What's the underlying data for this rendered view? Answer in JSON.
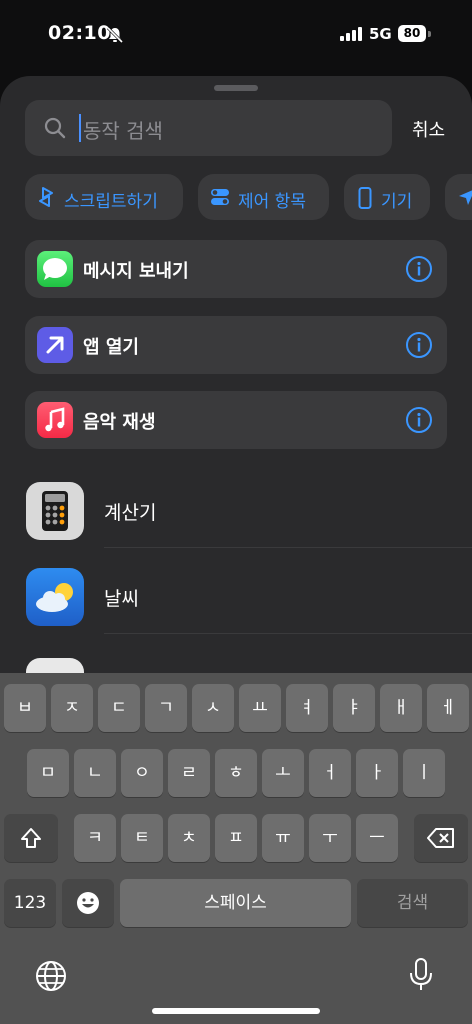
{
  "status_bar": {
    "time": "02:10",
    "network": "5G",
    "battery": "80"
  },
  "search": {
    "placeholder": "동작 검색",
    "cancel_label": "취소"
  },
  "chips": [
    {
      "label": "스크립트하기",
      "icon": "shortcut-icon"
    },
    {
      "label": "제어 항목",
      "icon": "toggle-icon"
    },
    {
      "label": "기기",
      "icon": "phone-icon"
    },
    {
      "label": "",
      "icon": "location-arrow-icon"
    }
  ],
  "suggestions": [
    {
      "label": "메시지 보내기",
      "icon": "messages-icon",
      "color": "#34c759"
    },
    {
      "label": "앱 열기",
      "icon": "arrow-up-right-icon",
      "color": "#5e5ce6"
    },
    {
      "label": "음악 재생",
      "icon": "music-icon",
      "color": "#fa2d48"
    }
  ],
  "apps": [
    {
      "label": "계산기",
      "icon": "calculator-icon"
    },
    {
      "label": "날씨",
      "icon": "weather-icon"
    }
  ],
  "keyboard": {
    "row1": [
      "ㅂ",
      "ㅈ",
      "ㄷ",
      "ㄱ",
      "ㅅ",
      "ㅛ",
      "ㅕ",
      "ㅑ",
      "ㅐ",
      "ㅔ"
    ],
    "row2": [
      "ㅁ",
      "ㄴ",
      "ㅇ",
      "ㄹ",
      "ㅎ",
      "ㅗ",
      "ㅓ",
      "ㅏ",
      "ㅣ"
    ],
    "row3": [
      "ㅋ",
      "ㅌ",
      "ㅊ",
      "ㅍ",
      "ㅠ",
      "ㅜ",
      "ㅡ"
    ],
    "numbers_label": "123",
    "space_label": "스페이스",
    "return_label": "검색"
  },
  "colors": {
    "accent": "#3a96ff",
    "sheet": "#2a2a2c",
    "cell": "#3a3a3c"
  }
}
